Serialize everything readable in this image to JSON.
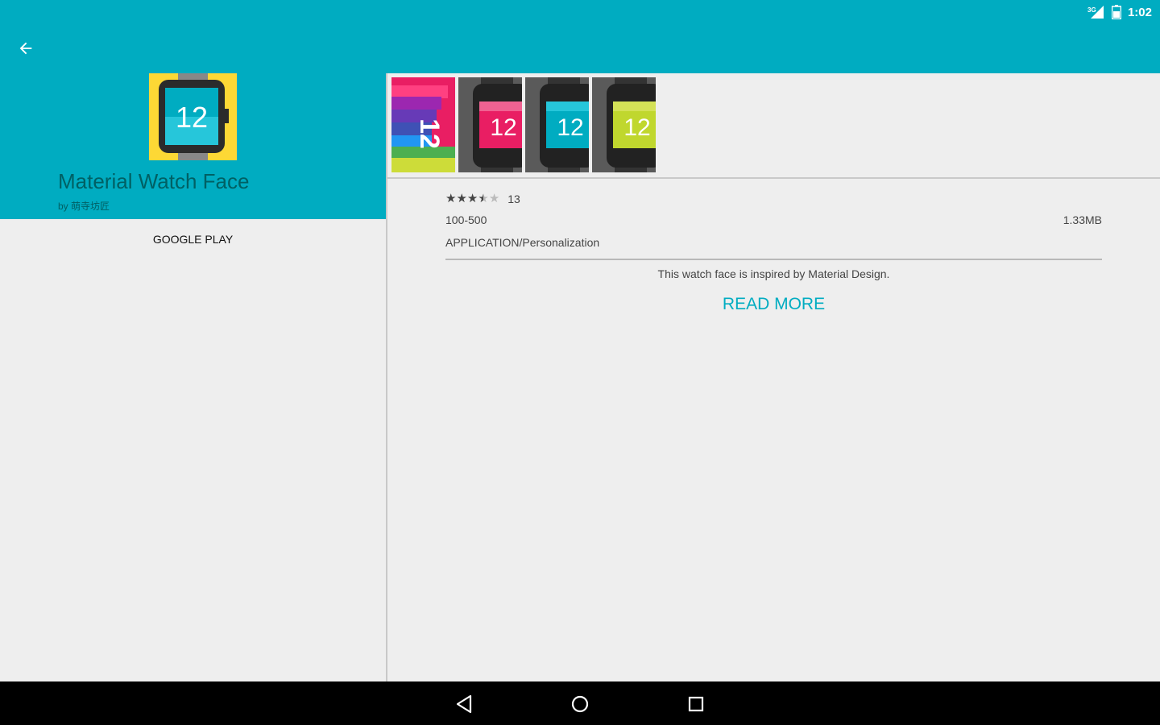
{
  "status": {
    "time": "1:02",
    "signal_icon": "signal-3g-icon",
    "battery_icon": "battery-icon"
  },
  "header": {
    "back_icon": "arrow-back-icon",
    "bg_color": "#00acc1"
  },
  "app": {
    "title": "Material Watch Face",
    "developer": "by 萌寺坊匠",
    "icon_number": "12",
    "google_play_label": "GOOGLE PLAY"
  },
  "screenshots": [
    {
      "number": "12",
      "style": "rainbow"
    },
    {
      "number": "12",
      "color": "#e91e63"
    },
    {
      "number": "12",
      "color": "#00acc1"
    },
    {
      "number": "12",
      "color": "#c0d72e"
    }
  ],
  "details": {
    "rating_stars": 3.5,
    "rating_count": "13",
    "downloads": "100-500",
    "size": "1.33MB",
    "category": "APPLICATION/Personalization",
    "description": "This watch face is inspired by Material Design.",
    "read_more": "READ MORE"
  },
  "navbar": {
    "back_icon": "nav-back-icon",
    "home_icon": "nav-home-icon",
    "recents_icon": "nav-recents-icon"
  }
}
